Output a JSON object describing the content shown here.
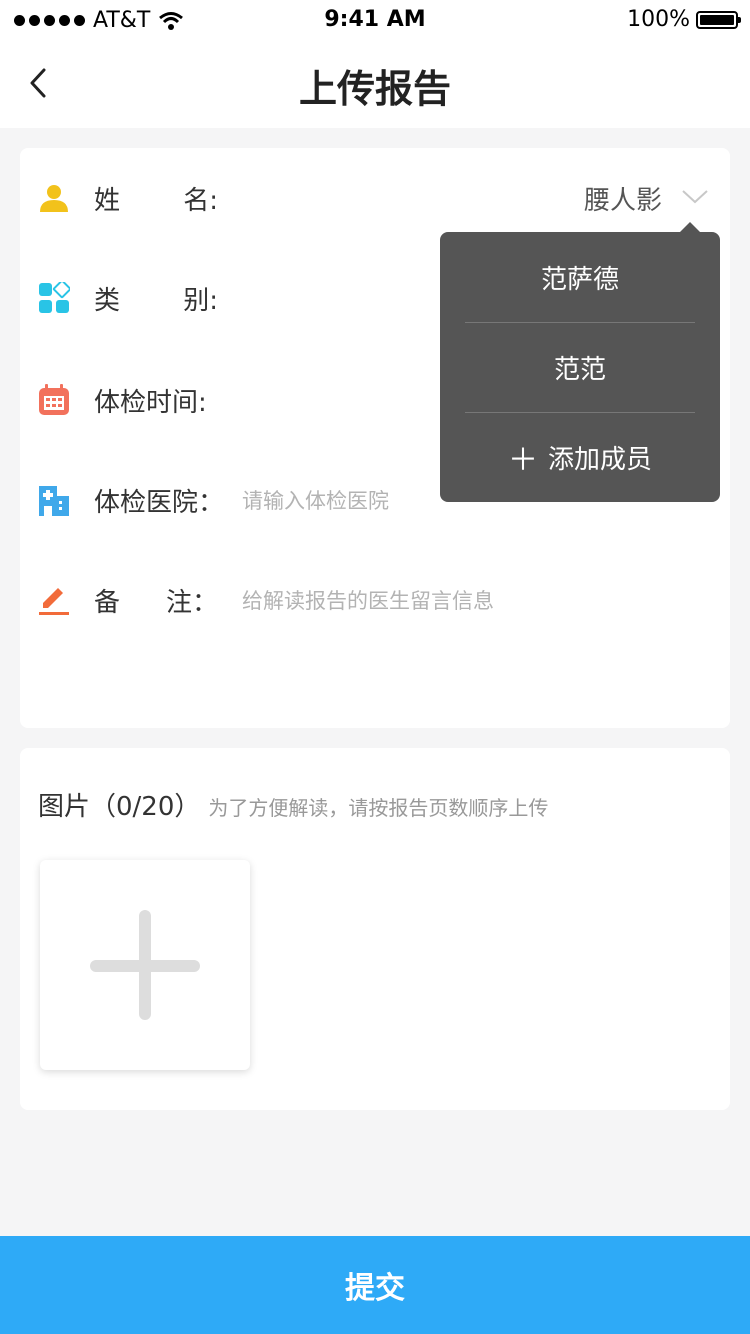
{
  "status_bar": {
    "carrier": "AT&T",
    "time": "9:41 AM",
    "battery": "100%"
  },
  "nav": {
    "title": "上传报告"
  },
  "form": {
    "name_label_a": "姓",
    "name_label_b": "名:",
    "name_value": "腰人影",
    "category_label_a": "类",
    "category_label_b": "别:",
    "time_label": "体检时间:",
    "hospital_label": "体检医院：",
    "hospital_placeholder": "请输入体检医院",
    "note_label_a": "备",
    "note_label_b": "注：",
    "note_placeholder": "给解读报告的医生留言信息"
  },
  "dropdown": {
    "items": [
      "范萨德",
      "范范"
    ],
    "add_label": "添加成员"
  },
  "photos": {
    "title": "图片（0/20）",
    "hint": "为了方便解读，请按报告页数顺序上传"
  },
  "submit_label": "提交",
  "colors": {
    "accent": "#2eaaf7",
    "user_icon": "#f2c21b",
    "category_icon": "#29c4e6",
    "calendar_icon": "#f2715c",
    "hospital_icon": "#3fa8ea",
    "edit_icon": "#f26b3a"
  }
}
